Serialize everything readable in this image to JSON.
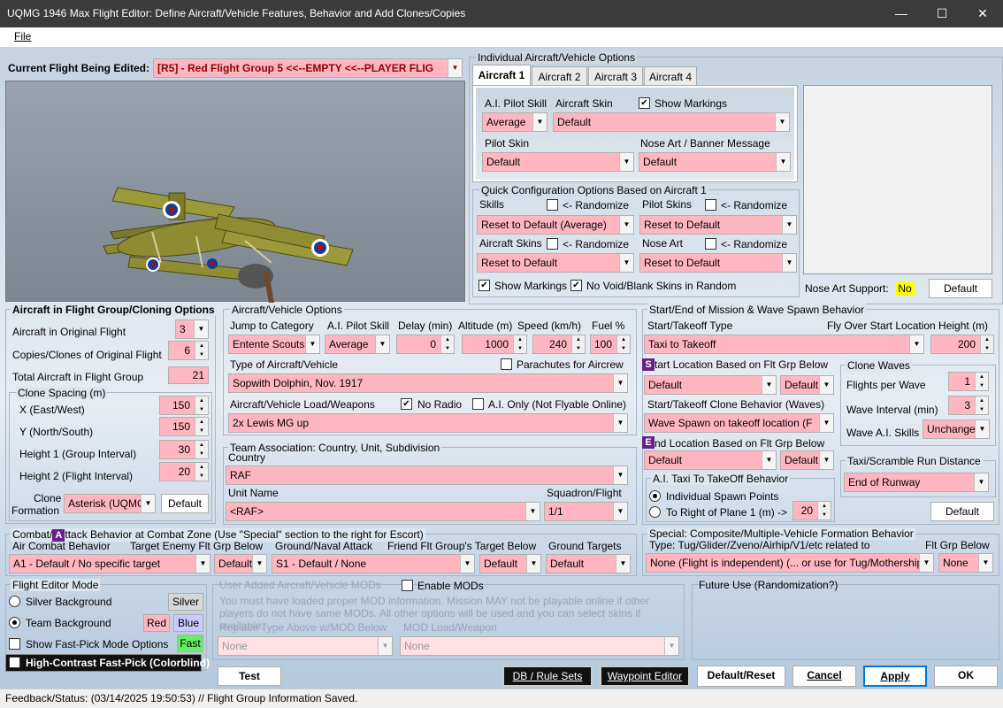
{
  "window": {
    "title": "UQMG 1946 Max Flight Editor:  Define Aircraft/Vehicle Features, Behavior and Add Clones/Copies",
    "min": "—",
    "max": "☐",
    "close": "✕"
  },
  "menu": {
    "file": "File"
  },
  "current_flight": {
    "label": "Current Flight Being Edited:",
    "value": "[R5] -  Red Flight Group  5    <<--EMPTY    <<--PLAYER FLIG"
  },
  "individual": {
    "title": "Individual Aircraft/Vehicle Options",
    "tabs": [
      "Aircraft 1",
      "Aircraft 2",
      "Aircraft 3",
      "Aircraft 4"
    ],
    "ai_skill_label": "A.I. Pilot Skill",
    "ai_skill": "Average",
    "skin_label": "Aircraft Skin",
    "skin": "Default",
    "show_markings": "Show Markings",
    "pilot_skin_label": "Pilot Skin",
    "pilot_skin": "Default",
    "nose_art_label": "Nose Art / Banner Message",
    "nose_art": "Default"
  },
  "quick": {
    "title": "Quick Configuration Options Based on Aircraft 1",
    "skills": "Skills",
    "randomize": "<- Randomize",
    "pilot_skins": "Pilot Skins",
    "skills_val": "Reset to Default (Average)",
    "pilot_skins_val": "Reset to Default",
    "aircraft_skins": "Aircraft Skins",
    "nose_art": "Nose Art",
    "aircraft_skins_val": "Reset to Default",
    "nose_art_val": "Reset to Default",
    "show_markings": "Show Markings",
    "no_void": "No Void/Blank Skins in Random"
  },
  "nose_support": {
    "label": "Nose Art Support:",
    "value": "No",
    "default_btn": "Default"
  },
  "cloning": {
    "title": "Aircraft in Flight Group/Cloning Options",
    "orig_label": "Aircraft in Original Flight",
    "orig": "3",
    "copies_label": "Copies/Clones of Original Flight",
    "copies": "6",
    "total_label": "Total Aircraft in Flight Group",
    "total": "21",
    "spacing_title": "Clone Spacing (m)",
    "x_label": "X (East/West)",
    "x": "150",
    "y_label": "Y (North/South)",
    "y": "150",
    "h1_label": "Height 1 (Group Interval)",
    "h1": "30",
    "h2_label": "Height 2 (Flight Interval)",
    "h2": "20",
    "formation_label1": "Clone",
    "formation_label2": "Formation",
    "formation": "Asterisk (UQMG)",
    "default_btn": "Default"
  },
  "vehicle": {
    "title": "Aircraft/Vehicle Options",
    "jump_label": "Jump to Category",
    "jump": "Entente Scouts",
    "skill_label": "A.I. Pilot Skill",
    "skill": "Average",
    "delay_label": "Delay (min)",
    "delay": "0",
    "alt_label": "Altitude (m)",
    "alt": "1000",
    "speed_label": "Speed (km/h)",
    "speed": "240",
    "fuel_label": "Fuel %",
    "fuel": "100",
    "type_label": "Type of Aircraft/Vehicle",
    "parachutes": "Parachutes for Aircrew",
    "type": "Sopwith Dolphin, Nov. 1917",
    "load_label": "Aircraft/Vehicle Load/Weapons",
    "no_radio": "No Radio",
    "ai_only": "A.I. Only (Not Flyable Online)",
    "load": "2x Lewis MG up"
  },
  "team": {
    "title": "Team Association:  Country, Unit, Subdivision",
    "country_label": "Country",
    "country": "RAF",
    "unit_label": "Unit Name",
    "unit": "<RAF>",
    "sq_label": "Squadron/Flight",
    "sq": "1/1"
  },
  "mission": {
    "title": "Start/End of Mission & Wave Spawn Behavior",
    "start_type_label": "Start/Takeoff Type",
    "start_type": "Taxi to Takeoff",
    "flyover_label": "Fly Over Start Location Height (m)",
    "flyover": "200",
    "start_loc_badge": "S",
    "start_loc_label": "tart Location Based on Flt Grp Below",
    "start_loc": "Default",
    "start_loc2": "Default",
    "clone_beh_label": "Start/Takeoff Clone Behavior (Waves)",
    "clone_beh": "Wave Spawn on takeoff location (F",
    "end_badge": "E",
    "end_label": "nd Location Based on Flt Grp Below",
    "end_loc": "Default",
    "end_loc2": "Default",
    "taxi_title": "A.I. Taxi To TakeOff Behavior",
    "taxi_opt1": "Individual Spawn Points",
    "taxi_opt2": "To Right of Plane 1 (m) ->",
    "taxi_val": "20",
    "waves_title": "Clone Waves",
    "fpw_label": "Flights per Wave",
    "fpw": "1",
    "wi_label": "Wave Interval (min)",
    "wi": "3",
    "wai_label": "Wave A.I. Skills",
    "wai": "Unchanged",
    "scramble_title": "Taxi/Scramble Run Distance",
    "scramble": "End of Runway",
    "default_btn": "Default"
  },
  "combat": {
    "title_a": "Combat/",
    "badge": "A",
    "title_b": "ttack Behavior at Combat Zone (Use \"Special\" section to the right for Escort)",
    "air_label": "Air Combat Behavior",
    "air": "A1 - Default / No specific target",
    "enemy_label": "Target Enemy Flt Grp Below",
    "enemy": "Default",
    "ground_label": "Ground/Naval Attack",
    "ground": "S1 - Default / None",
    "friend_label": "Friend Flt Group's Target Below",
    "friend": "Default",
    "gt_label": "Ground Targets",
    "gt": "Default"
  },
  "special": {
    "title": "Special: Composite/Multiple-Vehicle Formation Behavior",
    "type_label": "Type: Tug/Glider/Zveno/Airhip/V1/etc related to",
    "flt_label": "Flt Grp Below",
    "type": "None (Flight is independent) (... or use for Tug/Mothership",
    "flt": "None"
  },
  "mode": {
    "title": "Flight Editor Mode",
    "silver": "Silver Background",
    "silver_btn": "Silver",
    "team": "Team Background",
    "red_btn": "Red",
    "blue_btn": "Blue",
    "fastpick": "Show Fast-Pick Mode Options",
    "fast_btn": "Fast",
    "contrast": "High-Contrast Fast-Pick (Colorblind)"
  },
  "mods": {
    "title": "User Added Aircraft/Vehicle MODs",
    "enable": "Enable MODs",
    "note": "You must have loaded proper MOD information.  Mission MAY not be playable online if other players do not have same MODs.  All other options will be used and you can select skins if available.",
    "replace_label": "Replace Type Above w/MOD Below",
    "load_label": "MOD Load/Weapon",
    "replace": "None",
    "load": "None"
  },
  "future": {
    "title": "Future Use (Randomization?)"
  },
  "buttons": {
    "test": "Test",
    "db": "DB / Rule Sets",
    "waypoint": "Waypoint Editor",
    "reset": "Default/Reset",
    "cancel": "Cancel",
    "apply": "Apply",
    "ok": "OK"
  },
  "status": {
    "text": "Feedback/Status:  (03/14/2025 19:50:53) // Flight Group Information Saved."
  },
  "colors": {
    "field_pink": "#ffb6c1",
    "badge_purple": "#6b1f8a",
    "nose_yellow": "#ffff00",
    "fast_green": "#66ee66"
  }
}
